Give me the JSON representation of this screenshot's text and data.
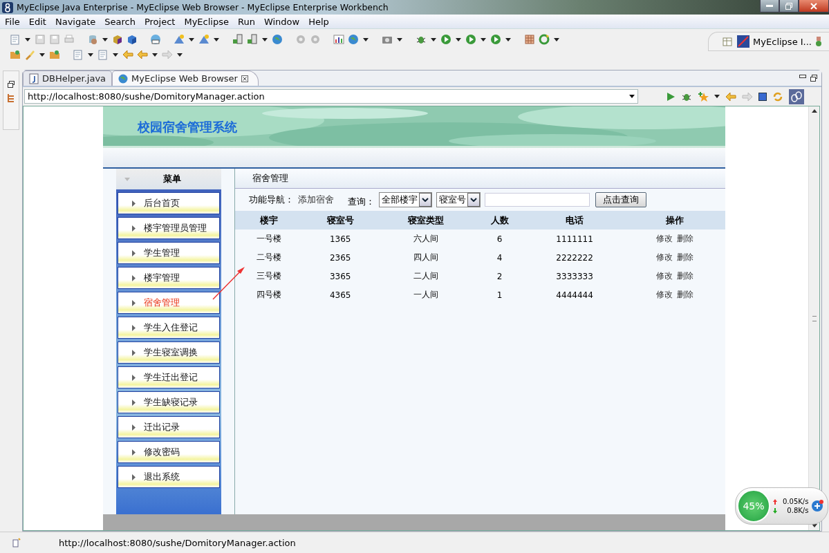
{
  "window": {
    "title": "MyEclipse Java Enterprise - MyEclipse Web Browser - MyEclipse Enterprise Workbench"
  },
  "menu_bar": [
    "File",
    "Edit",
    "Navigate",
    "Search",
    "Project",
    "MyEclipse",
    "Run",
    "Window",
    "Help"
  ],
  "perspective": {
    "label": "MyEclipse I..."
  },
  "editor_tabs": [
    {
      "label": "DBHelper.java",
      "selected": false
    },
    {
      "label": "MyEclipse Web Browser",
      "selected": true
    }
  ],
  "browser": {
    "url": "http://localhost:8080/sushe/DomitoryManager.action"
  },
  "page": {
    "site_title": "校园宿舍管理系统",
    "menu_title": "菜单",
    "side_menu": [
      {
        "label": "后台首页",
        "selected": false
      },
      {
        "label": "楼宇管理员管理",
        "selected": false
      },
      {
        "label": "学生管理",
        "selected": false
      },
      {
        "label": "楼宇管理",
        "selected": false
      },
      {
        "label": "宿舍管理",
        "selected": true
      },
      {
        "label": "学生入住登记",
        "selected": false
      },
      {
        "label": "学生寝室调换",
        "selected": false
      },
      {
        "label": "学生迁出登记",
        "selected": false
      },
      {
        "label": "学生缺寝记录",
        "selected": false
      },
      {
        "label": "迁出记录",
        "selected": false
      },
      {
        "label": "修改密码",
        "selected": false
      },
      {
        "label": "退出系统",
        "selected": false
      }
    ],
    "panel_title": "宿舍管理",
    "nav_label": "功能导航：",
    "nav_link": "添加宿舍",
    "query_label": "查询：",
    "building_select": "全部楼宇",
    "field_select": "寝室号",
    "search_button": "点击查询",
    "table": {
      "columns": [
        "楼宇",
        "寝室号",
        "寝室类型",
        "人数",
        "电话",
        "操作"
      ],
      "rows": [
        {
          "cells": [
            "一号楼",
            "1365",
            "六人间",
            "6",
            "1111111"
          ],
          "actions": [
            "修改",
            "删除"
          ]
        },
        {
          "cells": [
            "二号楼",
            "2365",
            "四人间",
            "4",
            "2222222"
          ],
          "actions": [
            "修改",
            "删除"
          ]
        },
        {
          "cells": [
            "三号楼",
            "3365",
            "二人间",
            "2",
            "3333333"
          ],
          "actions": [
            "修改",
            "删除"
          ]
        },
        {
          "cells": [
            "四号楼",
            "4365",
            "一人间",
            "1",
            "4444444"
          ],
          "actions": [
            "修改",
            "删除"
          ]
        }
      ]
    }
  },
  "status_bar": {
    "url": "http://localhost:8080/sushe/DomitoryManager.action"
  },
  "net_widget": {
    "percent": "45%",
    "upload": "0.05K/s",
    "download": "0.8K/s"
  }
}
